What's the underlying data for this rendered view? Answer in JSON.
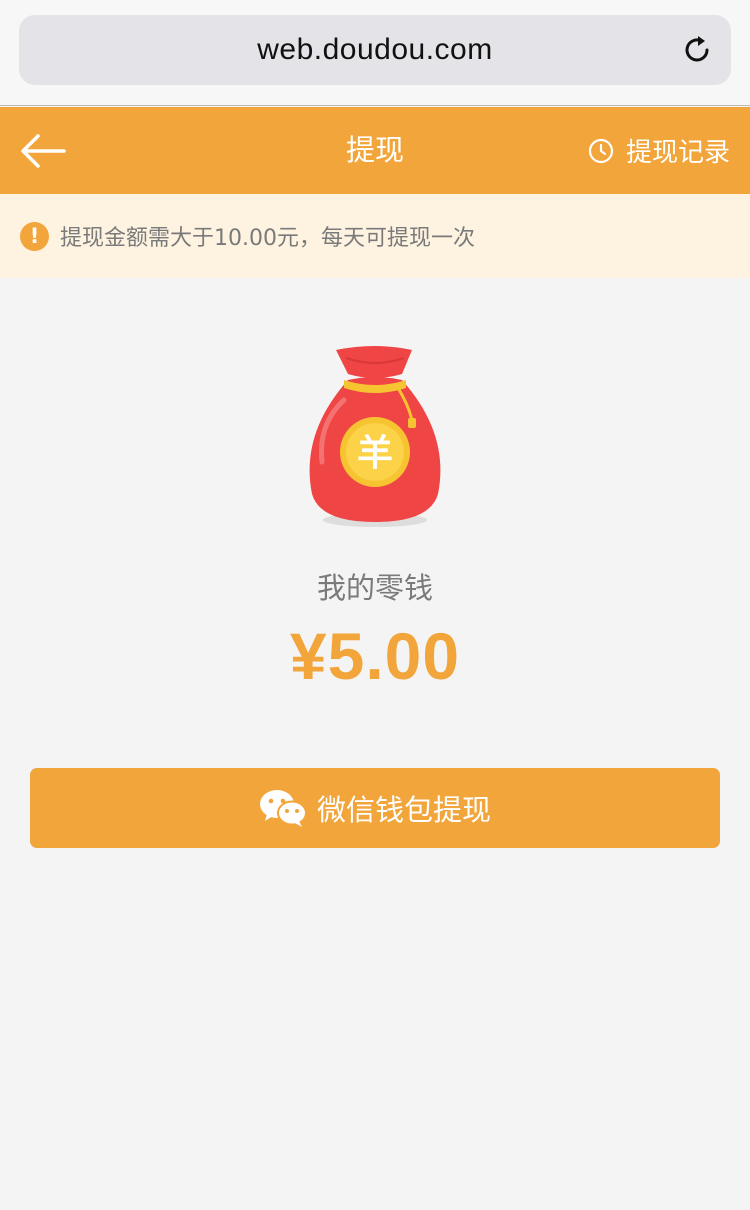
{
  "browser": {
    "url": "web.doudou.com",
    "reload_icon": "reload-icon"
  },
  "header": {
    "title": "提现",
    "back_icon": "back-arrow-icon",
    "history_label": "提现记录",
    "history_icon": "clock-icon"
  },
  "notice": {
    "icon": "warning-icon",
    "icon_glyph": "!",
    "text": "提现金额需大于10.00元，每天可提现一次"
  },
  "wallet": {
    "illustration": "money-bag-icon",
    "coin_glyph": "羊",
    "label": "我的零钱",
    "amount": "¥5.00"
  },
  "action": {
    "button_label": "微信钱包提现",
    "icon": "wechat-icon"
  },
  "colors": {
    "accent": "#f1a53a",
    "notice_bg": "#fef3e1",
    "page_bg": "#f4f4f4",
    "bag_red": "#f04545",
    "coin_yellow": "#f7c431"
  }
}
